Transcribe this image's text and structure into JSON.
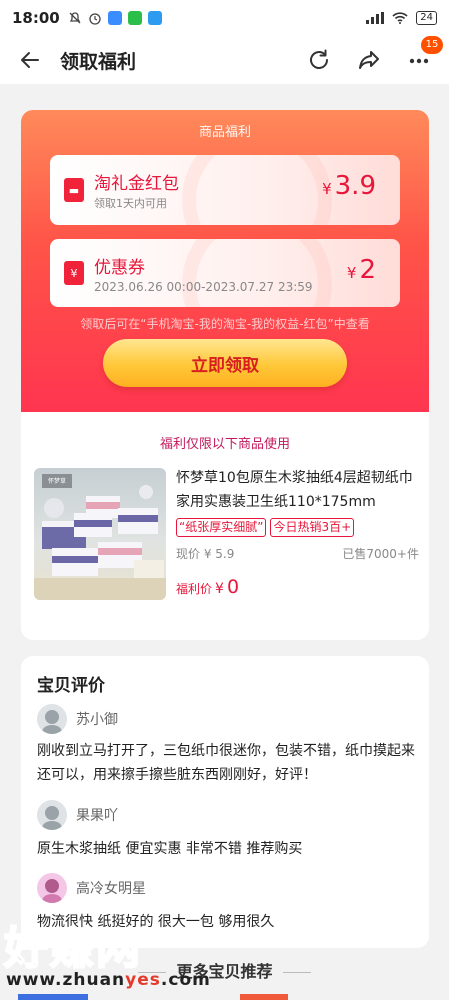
{
  "status_bar": {
    "time": "18:00",
    "battery": "24"
  },
  "nav": {
    "title": "领取福利",
    "badge": "15"
  },
  "welfare": {
    "section_title": "商品福利",
    "coupons": [
      {
        "name": "淘礼金红包",
        "subtitle": "领取1天内可用",
        "currency": "¥",
        "value": "3.9"
      },
      {
        "name": "优惠券",
        "subtitle": "2023.06.26 00:00-2023.07.27 23:59",
        "currency": "¥",
        "value": "2"
      }
    ],
    "notice": "领取后可在“手机淘宝-我的淘宝-我的权益-红包”中查看",
    "claim_button": "立即领取",
    "limited_note": "福利仅限以下商品使用"
  },
  "product": {
    "name": "怀梦草10包原生木浆抽纸4层超韧纸巾家用实惠装卫生纸110*175mm",
    "tags": [
      "“纸张厚实细腻”",
      "今日热销3百+"
    ],
    "current_price_label": "现价",
    "current_price": "¥ 5.9",
    "sold": "已售7000+件",
    "welfare_price_label": "福利价",
    "welfare_currency": "¥",
    "welfare_price": "0",
    "image_brand": "怀梦草"
  },
  "reviews": {
    "title": "宝贝评价",
    "items": [
      {
        "user": "苏小御",
        "text": "刚收到立马打开了，三包纸巾很迷你，包装不错，纸巾摸起来还可以，用来擦手擦些脏东西刚刚好，好评！"
      },
      {
        "user": "果果吖",
        "text": "原生木浆抽纸 便宜实惠 非常不错 推荐购买"
      },
      {
        "user": "高冷女明星",
        "text": "物流很快 纸挺好的 很大一包 够用很久"
      }
    ]
  },
  "more_title": "更多宝贝推荐",
  "watermark": {
    "big": "好赚网",
    "small_prefix": "www.zhuan",
    "small_accent": "yes",
    "small_suffix": ".com"
  },
  "colors": {
    "accent_red": "#e6173b",
    "button_yellow": "#ffc839",
    "brand_orange": "#ff5000"
  }
}
